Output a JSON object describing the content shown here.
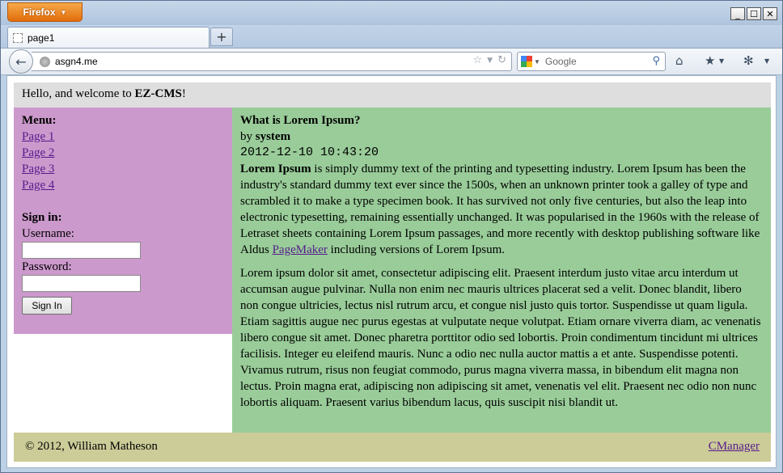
{
  "browser": {
    "app_button": "Firefox",
    "window_controls": {
      "minimize": "_",
      "maximize": "☐",
      "close": "✕"
    },
    "tab": {
      "title": "page1"
    },
    "new_tab": "+",
    "url": "asgn4.me",
    "search_placeholder": "Google"
  },
  "page": {
    "header": {
      "greeting": "Hello, and welcome to ",
      "brand": "EZ-CMS",
      "suffix": "!"
    },
    "menu": {
      "heading": "Menu:",
      "items": [
        "Page 1",
        "Page 2",
        "Page 3",
        "Page 4"
      ]
    },
    "signin": {
      "heading": "Sign in:",
      "username_label": "Username:",
      "username_value": "",
      "password_label": "Password:",
      "password_value": "",
      "button": "Sign In"
    },
    "article": {
      "title": "What is Lorem Ipsum?",
      "by_prefix": "by ",
      "author": "system",
      "timestamp": "2012-12-10 10:43:20",
      "p1_bold": "Lorem Ipsum",
      "p1_text": " is simply dummy text of the printing and typesetting industry. Lorem Ipsum has been the industry's standard dummy text ever since the 1500s, when an unknown printer took a galley of type and scrambled it to make a type specimen book. It has survived not only five centuries, but also the leap into electronic typesetting, remaining essentially unchanged. It was popularised in the 1960s with the release of Letraset sheets containing Lorem Ipsum passages, and more recently with desktop publishing software like Aldus ",
      "p1_link": "PageMaker",
      "p1_end": " including versions of Lorem Ipsum.",
      "p2": "Lorem ipsum dolor sit amet, consectetur adipiscing elit. Praesent interdum justo vitae arcu interdum ut accumsan augue pulvinar. Nulla non enim nec mauris ultrices placerat sed a velit. Donec blandit, libero non congue ultricies, lectus nisl rutrum arcu, et congue nisl justo quis tortor. Suspendisse ut quam ligula. Etiam sagittis augue nec purus egestas at vulputate neque volutpat. Etiam ornare viverra diam, ac venenatis libero congue sit amet. Donec pharetra porttitor odio sed lobortis. Proin condimentum tincidunt mi ultrices facilisis. Integer eu eleifend mauris. Nunc a odio nec nulla auctor mattis a et ante. Suspendisse potenti. Vivamus rutrum, risus non feugiat commodo, purus magna viverra massa, in bibendum elit magna non lectus. Proin magna erat, adipiscing non adipiscing sit amet, venenatis vel elit. Praesent nec odio non nunc lobortis aliquam. Praesent varius bibendum lacus, quis suscipit nisi blandit ut."
    },
    "footer": {
      "copyright": "© 2012, William Matheson",
      "link": "CManager"
    }
  },
  "colors": {
    "header_bg": "#dedede",
    "sidebar_bg": "#cc99cc",
    "main_bg": "#99cc99",
    "footer_bg": "#cccc99",
    "link": "#551a8b",
    "firefox_button": "#e8750f"
  },
  "icons": {
    "back": "back-arrow-icon",
    "page_favicon": "globe-icon",
    "bookmark_star": "star-icon",
    "reload": "reload-icon",
    "search_engine": "google-icon",
    "search": "magnifier-icon",
    "home": "home-icon",
    "bookmarks_menu": "bookmarks-icon",
    "addon": "bug-icon"
  }
}
